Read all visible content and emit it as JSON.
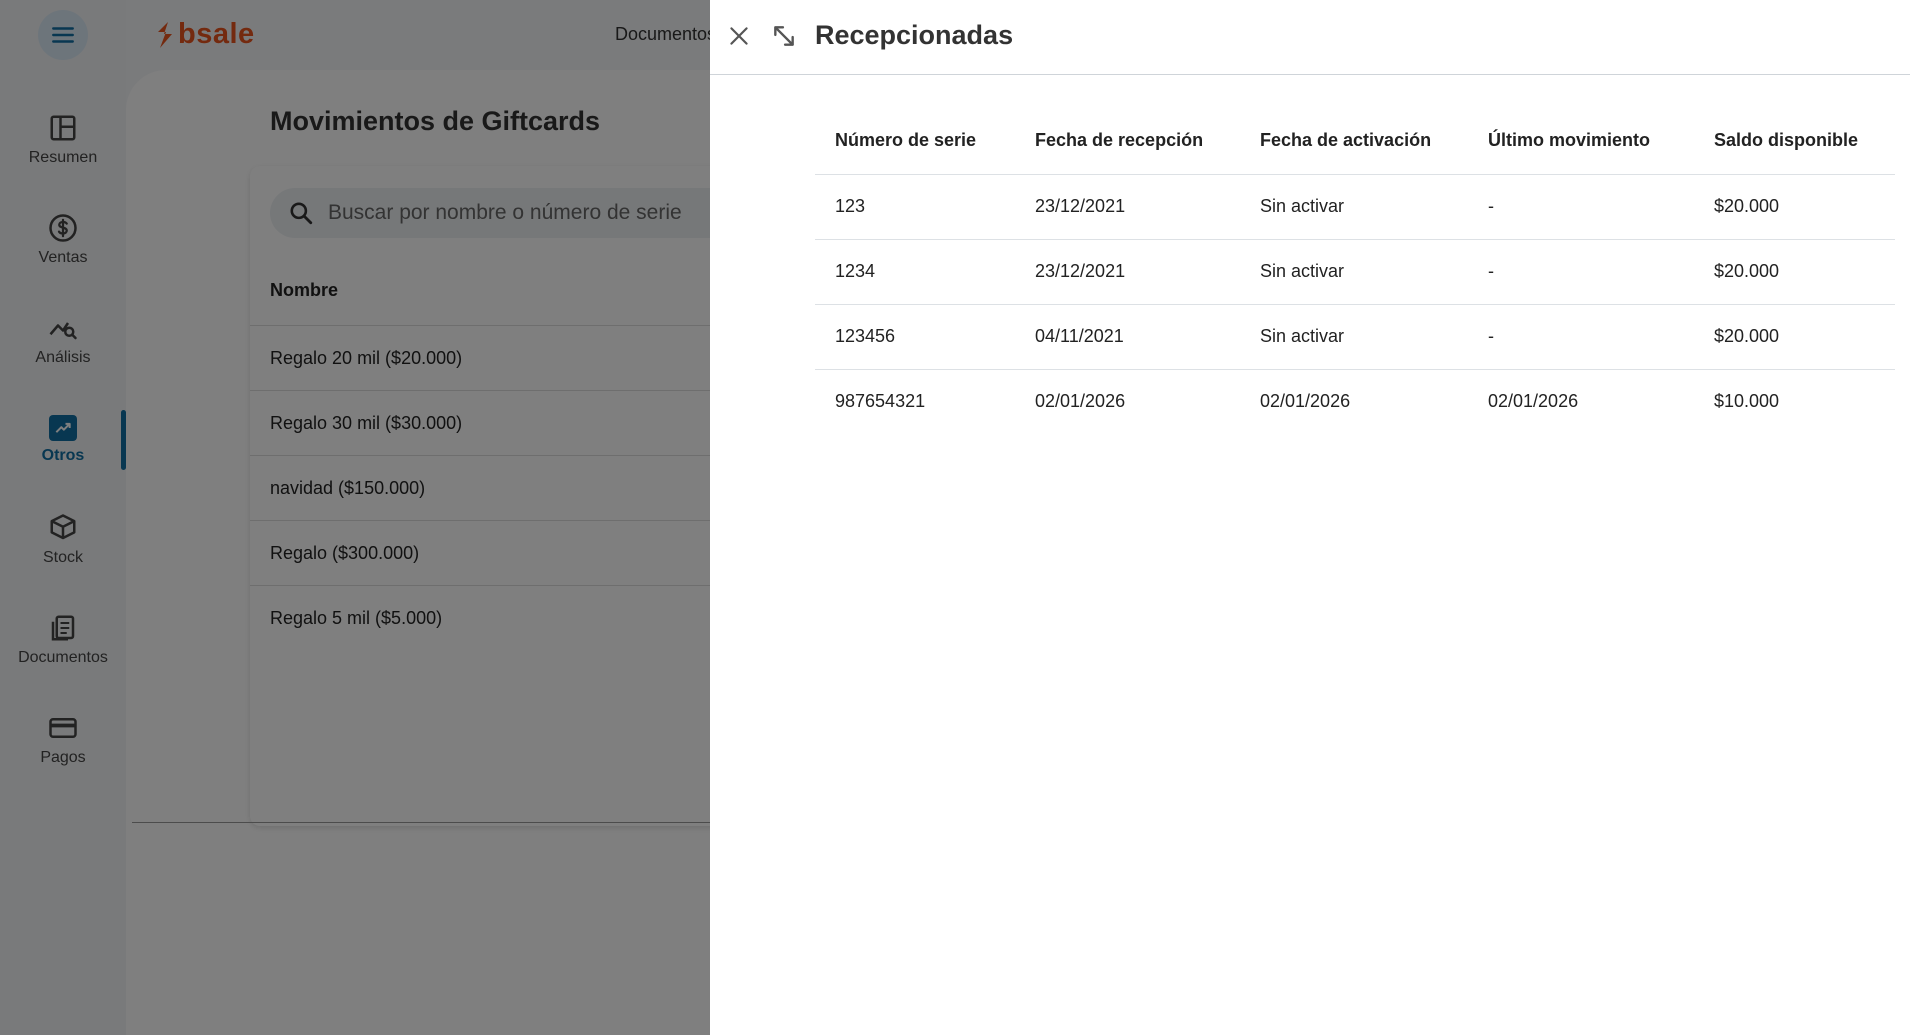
{
  "app": {
    "brand": "bsale",
    "top_nav_item": "Documentos"
  },
  "sidebar": {
    "items": [
      {
        "label": "Resumen",
        "icon": "dashboard-icon"
      },
      {
        "label": "Ventas",
        "icon": "dollar-icon"
      },
      {
        "label": "Análisis",
        "icon": "analytics-icon"
      },
      {
        "label": "Otros",
        "icon": "trending-up-icon",
        "active": true
      },
      {
        "label": "Stock",
        "icon": "box-icon"
      },
      {
        "label": "Documentos",
        "icon": "documents-icon"
      },
      {
        "label": "Pagos",
        "icon": "credit-card-icon"
      }
    ]
  },
  "page": {
    "title": "Movimientos de Giftcards",
    "search_placeholder": "Buscar por nombre o número de serie",
    "column_header": "Nombre",
    "rows": [
      "Regalo 20 mil ($20.000)",
      "Regalo 30 mil ($30.000)",
      "navidad ($150.000)",
      "Regalo ($300.000)",
      "Regalo 5 mil ($5.000)"
    ]
  },
  "drawer": {
    "title": "Recepcionadas",
    "columns": [
      "Número de serie",
      "Fecha de recepción",
      "Fecha de activación",
      "Último movimiento",
      "Saldo disponible"
    ],
    "rows": [
      [
        "123",
        "23/12/2021",
        "Sin activar",
        "-",
        "$20.000"
      ],
      [
        "1234",
        "23/12/2021",
        "Sin activar",
        "-",
        "$20.000"
      ],
      [
        "123456",
        "04/11/2021",
        "Sin activar",
        "-",
        "$20.000"
      ],
      [
        "987654321",
        "02/01/2026",
        "02/01/2026",
        "02/01/2026",
        "$10.000"
      ]
    ]
  },
  "colors": {
    "brand": "#e8541f",
    "accent": "#116fa3"
  }
}
